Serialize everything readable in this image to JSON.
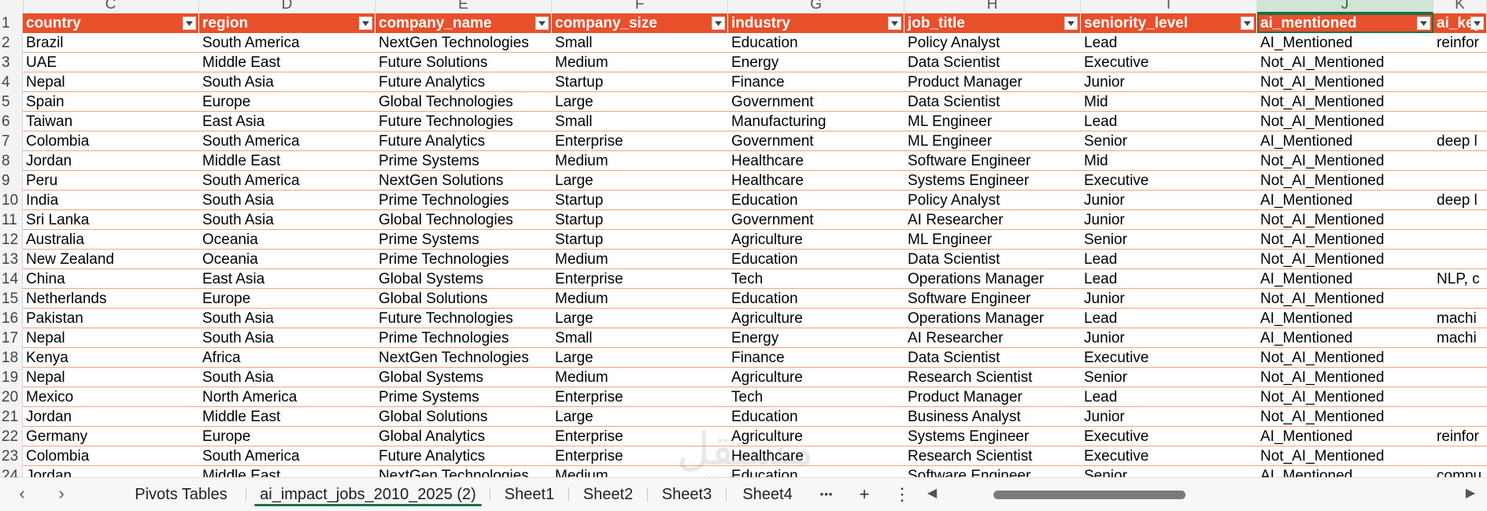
{
  "column_letters": [
    {
      "letter": "C",
      "selected": false
    },
    {
      "letter": "D",
      "selected": false
    },
    {
      "letter": "E",
      "selected": false
    },
    {
      "letter": "F",
      "selected": false
    },
    {
      "letter": "G",
      "selected": false
    },
    {
      "letter": "H",
      "selected": false
    },
    {
      "letter": "I",
      "selected": false
    },
    {
      "letter": "J",
      "selected": true
    },
    {
      "letter": "K",
      "selected": false
    }
  ],
  "headers": [
    "country",
    "region",
    "company_name",
    "company_size",
    "industry",
    "job_title",
    "seniority_level",
    "ai_mentioned",
    "ai_key"
  ],
  "active_header": "ai_mentioned",
  "rows": [
    {
      "n": "2",
      "cells": [
        "Brazil",
        "South America",
        "NextGen Technologies",
        "Small",
        "Education",
        "Policy Analyst",
        "Lead",
        "AI_Mentioned",
        "reinfor"
      ]
    },
    {
      "n": "3",
      "cells": [
        "UAE",
        "Middle East",
        "Future Solutions",
        "Medium",
        "Energy",
        "Data Scientist",
        "Executive",
        "Not_AI_Mentioned",
        ""
      ]
    },
    {
      "n": "4",
      "cells": [
        "Nepal",
        "South Asia",
        "Future Analytics",
        "Startup",
        "Finance",
        "Product Manager",
        "Junior",
        "Not_AI_Mentioned",
        ""
      ]
    },
    {
      "n": "5",
      "cells": [
        "Spain",
        "Europe",
        "Global Technologies",
        "Large",
        "Government",
        "Data Scientist",
        "Mid",
        "Not_AI_Mentioned",
        ""
      ]
    },
    {
      "n": "6",
      "cells": [
        "Taiwan",
        "East Asia",
        "Future Technologies",
        "Small",
        "Manufacturing",
        "ML Engineer",
        "Lead",
        "Not_AI_Mentioned",
        ""
      ]
    },
    {
      "n": "7",
      "cells": [
        "Colombia",
        "South America",
        "Future Analytics",
        "Enterprise",
        "Government",
        "ML Engineer",
        "Senior",
        "AI_Mentioned",
        "deep l"
      ]
    },
    {
      "n": "8",
      "cells": [
        "Jordan",
        "Middle East",
        "Prime Systems",
        "Medium",
        "Healthcare",
        "Software Engineer",
        "Mid",
        "Not_AI_Mentioned",
        ""
      ]
    },
    {
      "n": "9",
      "cells": [
        "Peru",
        "South America",
        "NextGen Solutions",
        "Large",
        "Healthcare",
        "Systems Engineer",
        "Executive",
        "Not_AI_Mentioned",
        ""
      ]
    },
    {
      "n": "10",
      "cells": [
        "India",
        "South Asia",
        "Prime Technologies",
        "Startup",
        "Education",
        "Policy Analyst",
        "Junior",
        "AI_Mentioned",
        "deep l"
      ]
    },
    {
      "n": "11",
      "cells": [
        "Sri Lanka",
        "South Asia",
        "Global Technologies",
        "Startup",
        "Government",
        "AI Researcher",
        "Junior",
        "Not_AI_Mentioned",
        ""
      ]
    },
    {
      "n": "12",
      "cells": [
        "Australia",
        "Oceania",
        "Prime Systems",
        "Startup",
        "Agriculture",
        "ML Engineer",
        "Senior",
        "Not_AI_Mentioned",
        ""
      ]
    },
    {
      "n": "13",
      "cells": [
        "New Zealand",
        "Oceania",
        "Prime Technologies",
        "Medium",
        "Education",
        "Data Scientist",
        "Lead",
        "Not_AI_Mentioned",
        ""
      ]
    },
    {
      "n": "14",
      "cells": [
        "China",
        "East Asia",
        "Global Systems",
        "Enterprise",
        "Tech",
        "Operations Manager",
        "Lead",
        "AI_Mentioned",
        "NLP, c"
      ]
    },
    {
      "n": "15",
      "cells": [
        "Netherlands",
        "Europe",
        "Global Solutions",
        "Medium",
        "Education",
        "Software Engineer",
        "Junior",
        "Not_AI_Mentioned",
        ""
      ]
    },
    {
      "n": "16",
      "cells": [
        "Pakistan",
        "South Asia",
        "Future Technologies",
        "Large",
        "Agriculture",
        "Operations Manager",
        "Lead",
        "AI_Mentioned",
        "machi"
      ]
    },
    {
      "n": "17",
      "cells": [
        "Nepal",
        "South Asia",
        "Prime Technologies",
        "Small",
        "Energy",
        "AI Researcher",
        "Junior",
        "AI_Mentioned",
        "machi"
      ]
    },
    {
      "n": "18",
      "cells": [
        "Kenya",
        "Africa",
        "NextGen Technologies",
        "Large",
        "Finance",
        "Data Scientist",
        "Executive",
        "Not_AI_Mentioned",
        ""
      ]
    },
    {
      "n": "19",
      "cells": [
        "Nepal",
        "South Asia",
        "Global Systems",
        "Medium",
        "Agriculture",
        "Research Scientist",
        "Senior",
        "Not_AI_Mentioned",
        ""
      ]
    },
    {
      "n": "20",
      "cells": [
        "Mexico",
        "North America",
        "Prime Systems",
        "Enterprise",
        "Tech",
        "Product Manager",
        "Lead",
        "Not_AI_Mentioned",
        ""
      ]
    },
    {
      "n": "21",
      "cells": [
        "Jordan",
        "Middle East",
        "Global Solutions",
        "Large",
        "Education",
        "Business Analyst",
        "Junior",
        "Not_AI_Mentioned",
        ""
      ]
    },
    {
      "n": "22",
      "cells": [
        "Germany",
        "Europe",
        "Global Analytics",
        "Enterprise",
        "Agriculture",
        "Systems Engineer",
        "Executive",
        "AI_Mentioned",
        "reinfor"
      ]
    },
    {
      "n": "23",
      "cells": [
        "Colombia",
        "South America",
        "Future Analytics",
        "Enterprise",
        "Healthcare",
        "Research Scientist",
        "Executive",
        "Not_AI_Mentioned",
        ""
      ]
    },
    {
      "n": "24",
      "cells": [
        "Jordan",
        "Middle East",
        "NextGen Technologies",
        "Medium",
        "Education",
        "Software Engineer",
        "Senior",
        "AI_Mentioned",
        "compu"
      ]
    }
  ],
  "sheet_tabs": [
    {
      "label": "Pivots Tables",
      "active": false
    },
    {
      "label": "ai_impact_jobs_2010_2025 (2)",
      "active": true
    },
    {
      "label": "Sheet1",
      "active": false
    },
    {
      "label": "Sheet2",
      "active": false
    },
    {
      "label": "Sheet3",
      "active": false
    },
    {
      "label": "Sheet4",
      "active": false
    }
  ],
  "tab_controls": {
    "prev": "‹",
    "next": "›",
    "more": "•••",
    "add": "+",
    "menu": "⋮"
  },
  "watermark": {
    "arabic": "مستقل",
    "latin": "mostaql.com"
  },
  "colors": {
    "header_fill": "#e8502b",
    "row_border": "#f2a386",
    "selection": "#1e7145"
  }
}
